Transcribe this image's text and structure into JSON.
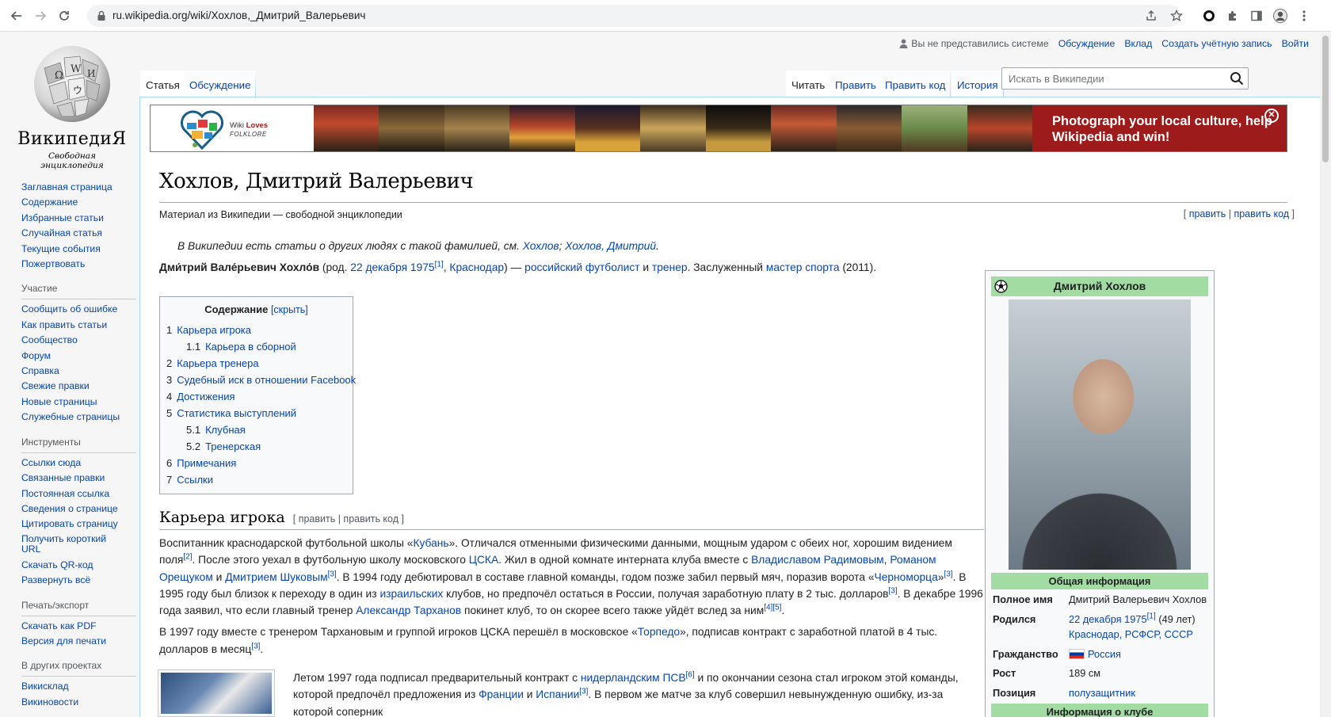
{
  "browser": {
    "url": "ru.wikipedia.org/wiki/Хохлов,_Дмитрий_Валерьевич"
  },
  "logo": {
    "wordmark": "ВикипедиЯ",
    "tagline": "Свободная энциклопедия"
  },
  "personal": {
    "anon": "Вы не представились системе",
    "links": [
      "Обсуждение",
      "Вклад",
      "Создать учётную запись",
      "Войти"
    ]
  },
  "tabs": {
    "left": [
      "Статья",
      "Обсуждение"
    ],
    "right": [
      "Читать",
      "Править",
      "Править код",
      "История"
    ]
  },
  "search": {
    "placeholder": "Искать в Википедии"
  },
  "sidebar": {
    "main": [
      "Заглавная страница",
      "Содержание",
      "Избранные статьи",
      "Случайная статья",
      "Текущие события",
      "Пожертвовать"
    ],
    "participation": {
      "heading": "Участие",
      "items": [
        "Сообщить об ошибке",
        "Как править статьи",
        "Сообщество",
        "Форум",
        "Справка",
        "Свежие правки",
        "Новые страницы",
        "Служебные страницы"
      ]
    },
    "tools": {
      "heading": "Инструменты",
      "items": [
        "Ссылки сюда",
        "Связанные правки",
        "Постоянная ссылка",
        "Сведения о странице",
        "Цитировать страницу",
        "Получить короткий URL",
        "Скачать QR-код",
        "Развернуть всё"
      ]
    },
    "print": {
      "heading": "Печать/экспорт",
      "items": [
        "Скачать как PDF",
        "Версия для печати"
      ]
    },
    "projects": {
      "heading": "В других проектах",
      "items": [
        "Викисклад",
        "Викиновости"
      ]
    }
  },
  "banner": {
    "logo_line1": "Wiki",
    "logo_line1b": "Loves",
    "logo_line2": "FOLKLORE",
    "cta": "Photograph your local culture, help Wikipedia and win!",
    "close": "✕"
  },
  "article": {
    "title": "Хохлов, Дмитрий Валерьевич",
    "tagline": "Материал из Википедии — свободной энциклопедии",
    "edit_links": [
      "править",
      "править код"
    ],
    "hatnote_prefix": "В Википедии есть статьи о других людях с такой фамилией, см.",
    "hatnote_links": [
      "Хохлов",
      "Хохлов, Дмитрий"
    ],
    "lead": {
      "name": "Дми́трий Вале́рьевич Хохло́в",
      "t1": " (род. ",
      "date": "22 декабря 1975",
      "ref1": "[1]",
      "comma": ", ",
      "city": "Краснодар",
      "t2": ") — ",
      "l1": "российский футболист",
      "and": " и ",
      "l2": "тренер",
      "t3": ". Заслуженный ",
      "l3": "мастер спорта",
      "t4": " (2011)."
    },
    "toc": {
      "title": "Содержание",
      "toggle": "[скрыть]",
      "items": [
        {
          "n": "1",
          "t": "Карьера игрока",
          "sub": false
        },
        {
          "n": "1.1",
          "t": "Карьера в сборной",
          "sub": true
        },
        {
          "n": "2",
          "t": "Карьера тренера",
          "sub": false
        },
        {
          "n": "3",
          "t": "Судебный иск в отношении Facebook",
          "sub": false
        },
        {
          "n": "4",
          "t": "Достижения",
          "sub": false
        },
        {
          "n": "5",
          "t": "Статистика выступлений",
          "sub": false
        },
        {
          "n": "5.1",
          "t": "Клубная",
          "sub": true
        },
        {
          "n": "5.2",
          "t": "Тренерская",
          "sub": true
        },
        {
          "n": "6",
          "t": "Примечания",
          "sub": false
        },
        {
          "n": "7",
          "t": "Ссылки",
          "sub": false
        }
      ]
    },
    "section1": {
      "heading": "Карьера игрока",
      "edit": "[ править | править код ]",
      "p1": {
        "a": "Воспитанник краснодарской футбольной школы «",
        "kuban": "Кубань",
        "b": "». Отличался отменными физическими данными, мощным ударом с обеих ног, хорошим видением поля",
        "r2": "[2]",
        "c": ". После этого уехал в футбольную школу московского ",
        "cska": "ЦСКА",
        "d": ". Жил в одной комнате интерната клуба вместе с ",
        "rad": "Владиславом Радимовым",
        "e": ", ",
        "ores": "Романом Орещуком",
        "f": " и ",
        "shuk": "Дмитрием Шуковым",
        "r3a": "[3]",
        "g": ". В 1994 году дебютировал в составе главной команды, годом позже забил первый мяч, поразив ворота «",
        "chern": "Черноморца",
        "h": "»",
        "r3b": "[3]",
        "i": ". В 1995 году был близок к переходу в один из ",
        "isr": "израильских",
        "j": " клубов, но предпочёл остаться в России, получая заработную плату в 2 тыс. долларов",
        "r3c": "[3]",
        "k": ". В декабре 1996 года заявил, что если главный тренер ",
        "tar": "Александр Тарханов",
        "l": " покинет клуб, то он скорее всего также уйдёт вслед за ним",
        "r45": "[4][5]",
        "m": "."
      },
      "p2": {
        "a": "В 1997 году вместе с тренером Тархановым и группой игроков ЦСКА перешёл в московское «",
        "torp": "Торпедо",
        "b": "», подписав контракт с заработной платой в 4 тыс. долларов в месяц",
        "r3": "[3]",
        "c": "."
      },
      "p3": {
        "a": "Летом 1997 года подписал предварительный контракт с ",
        "psv": "нидерландским ПСВ",
        "r6": "[6]",
        "b": " и по окончании сезона стал игроком этой команды, которой предпочёл предложения из ",
        "fr": "Франции",
        "c": " и ",
        "sp": "Испании",
        "r3": "[3]",
        "d": ". В первом же матче за клуб совершил невынужденную ошибку, из-за которой соперник"
      }
    }
  },
  "infobox": {
    "name": "Дмитрий Хохлов",
    "section_general": "Общая информация",
    "rows": {
      "fullname_k": "Полное имя",
      "fullname_v": "Дмитрий Валерьевич Хохлов",
      "born_k": "Родился",
      "born_date": "22 декабря 1975",
      "born_ref": "[1]",
      "born_age": " (49 лет)",
      "born_place": "Краснодар, РСФСР, СССР",
      "citizen_k": "Гражданство",
      "citizen_v": "Россия",
      "height_k": "Рост",
      "height_v": "189 см",
      "pos_k": "Позиция",
      "pos_v": "полузащитник"
    },
    "section_club": "Информация о клубе"
  }
}
